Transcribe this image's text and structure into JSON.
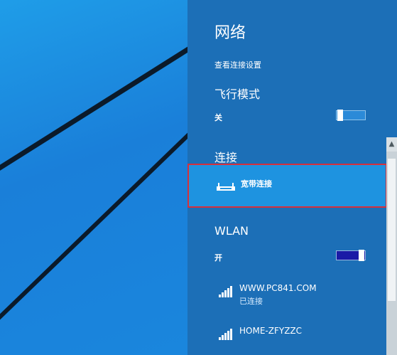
{
  "panel": {
    "title": "网络",
    "settings_link": "查看连接设置"
  },
  "airplane": {
    "heading": "飞行模式",
    "state": "关",
    "on": false
  },
  "connections": {
    "heading": "连接",
    "broadband_label": "宽带连接"
  },
  "wlan": {
    "heading": "WLAN",
    "state": "开",
    "on": true,
    "networks": [
      {
        "ssid": "WWW.PC841.COM",
        "status": "已连接"
      },
      {
        "ssid": "HOME-ZFYZZC",
        "status": ""
      }
    ]
  },
  "icons": {
    "broadband": "modem-icon",
    "wifi": "wifi-signal-icon",
    "scroll_up": "chevron-up-icon"
  },
  "colors": {
    "panel_bg": "#1c6fb7",
    "highlight_bg": "#1e93e0",
    "highlight_border": "#d6303c",
    "desktop_bg": "#1a86dd"
  }
}
